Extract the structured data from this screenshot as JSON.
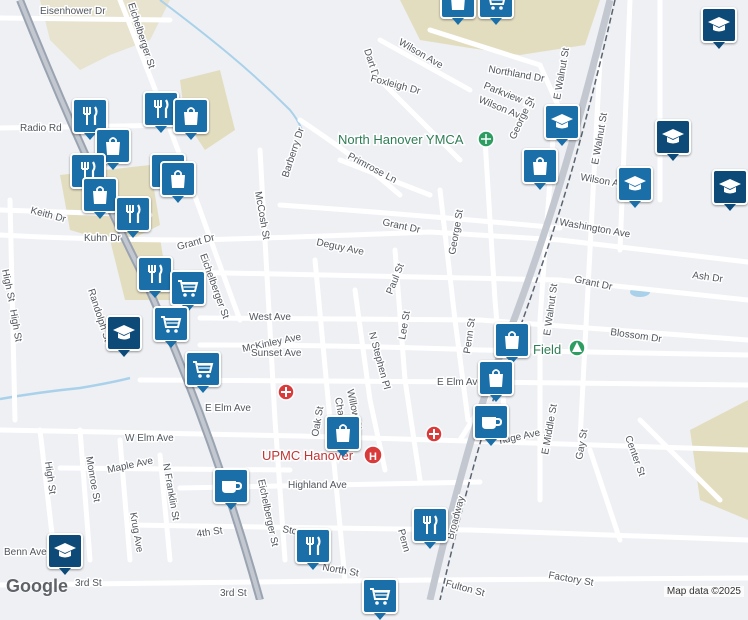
{
  "colors": {
    "land": "#eef0f4",
    "road": "#ffffff",
    "highway": "#9aa3b0",
    "rail": "#5b6470",
    "park": "#e3ddc0",
    "water": "#a9d1ea",
    "pin_primary": "#1a6fa8",
    "pin_dark": "#0d4a78",
    "poi_green": "#2e9d62",
    "poi_red": "#d93a3a"
  },
  "streets": [
    "Eisenhower Dr",
    "Eichelberger St",
    "Dart Dr",
    "Wilson Ave",
    "Foxleigh Dr",
    "Northland Dr",
    "Parkview Ln",
    "Wilson Ave",
    "George St",
    "Radio Rd",
    "Barberry Dr",
    "Primrose Ln",
    "Keith Dr",
    "Kuhn Dr",
    "Grant Dr",
    "Deguy Ave",
    "Grant Dr",
    "Washington Ave",
    "E Walnut St",
    "Randolph St",
    "High St",
    "Eichelberger St",
    "McCosh St",
    "George St",
    "Paul St",
    "Ash Dr",
    "Grant Dr",
    "West Ave",
    "McKinley Ave",
    "Lee St",
    "Penn St",
    "E Walnut St",
    "Blossom Dr",
    "Sunset Ave",
    "N Stephen Pl",
    "Willow St",
    "E Elm Ave",
    "E Elm Ave",
    "W Elm Ave",
    "Oak St",
    "Cha",
    "Maple Ave",
    "Monroe St",
    "N Franklin St",
    "High St",
    "Krug Ave",
    "Highland Ave",
    "E Middle St",
    "Gay St",
    "Center St",
    "4th St",
    "Eichelberger St",
    "Stock St",
    "North St",
    "Broadway",
    "Penn",
    "Fulton St",
    "Factory St",
    "Benn Ave",
    "3rd St",
    "3rd St",
    "Field",
    "ridge Ave",
    "E Walnut St",
    "Wilson Ave",
    "High St"
  ],
  "places": {
    "ymca": "North Hanover YMCA",
    "hospital": "UPMC Hanover"
  },
  "pins": [
    {
      "icon": "school-icon"
    },
    {
      "icon": "shopping-bag-icon"
    },
    {
      "icon": "shopping-cart-icon"
    },
    {
      "icon": "restaurant-icon"
    },
    {
      "icon": "cafe-icon"
    }
  ],
  "branding": {
    "logo": "Google",
    "attribution": "Map data ©2025"
  }
}
